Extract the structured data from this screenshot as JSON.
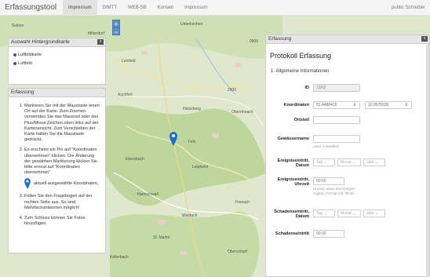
{
  "navbar": {
    "brand": "Erfassungstool",
    "items": [
      "Impressum",
      "DIMTT",
      "WEB-SB",
      "Kontakt",
      "Impressum"
    ],
    "active_index": 0,
    "user": "public Schreiber"
  },
  "zoom": {
    "in": "+",
    "out": "−"
  },
  "bg_panel": {
    "title": "Auswahl Hintergrundkarte",
    "close": "x",
    "options": [
      "Luftbildkarte",
      "Luftbild"
    ]
  },
  "help_panel": {
    "title": "Erfassung",
    "steps": [
      "Markieren Sie mit der Maustaste einen Ort auf der Karte. Zum Zoomen verwenden Sie das Mausrad oder das Plus/Minus Zeichen oben links auf der Kartenansicht. Zum Verschieben der Karte halten Sie die Maustaste gedrückt.",
      "Es erscheint ein Pin auf \"Koordinaten übernehmen\" klicken. Die Änderung der gewählten Markierung klicken Sie bitte erneut auf \"Koordinaten übernehmen\"",
      "Füllen Sie den Fragebogen auf der rechten Seite aus. So sind Mehrfachantworten möglich!",
      "Zum Schluss können Sie Fotos hinzufügen."
    ],
    "pin_text": "aktuell ausgewählte Koordinaten."
  },
  "form_panel": {
    "header": "Erfassung",
    "close": "x",
    "title": "Protokoll Erfassung",
    "section": "1. Allgemeine Informationen",
    "fields": {
      "id_label": "ID",
      "id_value": "13/62",
      "coord_label": "Koordinaten",
      "lat": "51.4488415",
      "lon": "10.9576930",
      "ortsteil_label": "Ortsteil",
      "gewaesser_label": "Gewässername",
      "gewaesser_hint": "unter Auswählen",
      "ereignis_label": "Ereigniseintritt, Datum",
      "ereignis_uhr_label": "Ereigniseintritt, Uhrzeit",
      "ereignis_uhr_placeholder": "00:00",
      "ereignis_hint": "Uhrzeit, wann das Ereignis zugtrat. Format z.B. 06:30",
      "schaden_label": "Schadenseintritt, Datum",
      "schaden_uhr_label": "Schadenseintritt",
      "schaden_uhr_placeholder": "00:00",
      "tag": "Tag",
      "monat": "Monat",
      "jahr": "Jahr"
    }
  },
  "map_labels": [
    "Sieben",
    "Mitterdorf",
    "Unterkirchen",
    "0800",
    "2900",
    "Leinfeld",
    "Auchfort",
    "Heinzberg",
    "Oberrinnach",
    "Fels",
    "Ebersbach",
    "Leipheim",
    "Hainschwall",
    "Weidach",
    "St. Martin",
    "Oberscharf",
    "Kellerbach",
    "Fresach"
  ],
  "colors": {
    "accent": "#5b8fd1",
    "pin": "#1f6fd0"
  }
}
